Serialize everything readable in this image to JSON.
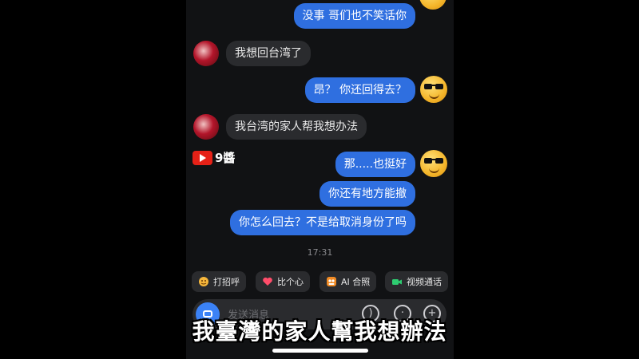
{
  "messages": [
    {
      "id": "m1",
      "side": "out",
      "text": "没事 哥们也不笑话你"
    },
    {
      "id": "m2",
      "side": "in",
      "text": "我想回台湾了"
    },
    {
      "id": "m3",
      "side": "out",
      "text": "昂？ 你还回得去？"
    },
    {
      "id": "m4",
      "side": "in",
      "text": "我台湾的家人帮我想办法"
    },
    {
      "id": "m5",
      "side": "out",
      "text": "那.....也挺好"
    },
    {
      "id": "m6",
      "side": "out",
      "text": "你还有地方能撤"
    },
    {
      "id": "m7",
      "side": "out",
      "text": "你怎么回去？不是给取消身份了吗"
    }
  ],
  "timestamp": "17:31",
  "watermark": {
    "label": "9醬",
    "icon": "youtube-logo-icon"
  },
  "quick_replies": [
    {
      "label": "打招呼",
      "icon": "wave-emoji-icon"
    },
    {
      "label": "比个心",
      "icon": "heart-icon"
    },
    {
      "label": "AI 合照",
      "icon": "ai-photo-icon"
    },
    {
      "label": "视频通话",
      "icon": "video-call-icon"
    }
  ],
  "input": {
    "placeholder": "发送消息"
  },
  "subtitle": "我臺灣的家人幫我想辦法",
  "colors": {
    "outgoing": "#2f6fe0",
    "incoming": "#2a2b2e",
    "background": "#111214"
  }
}
